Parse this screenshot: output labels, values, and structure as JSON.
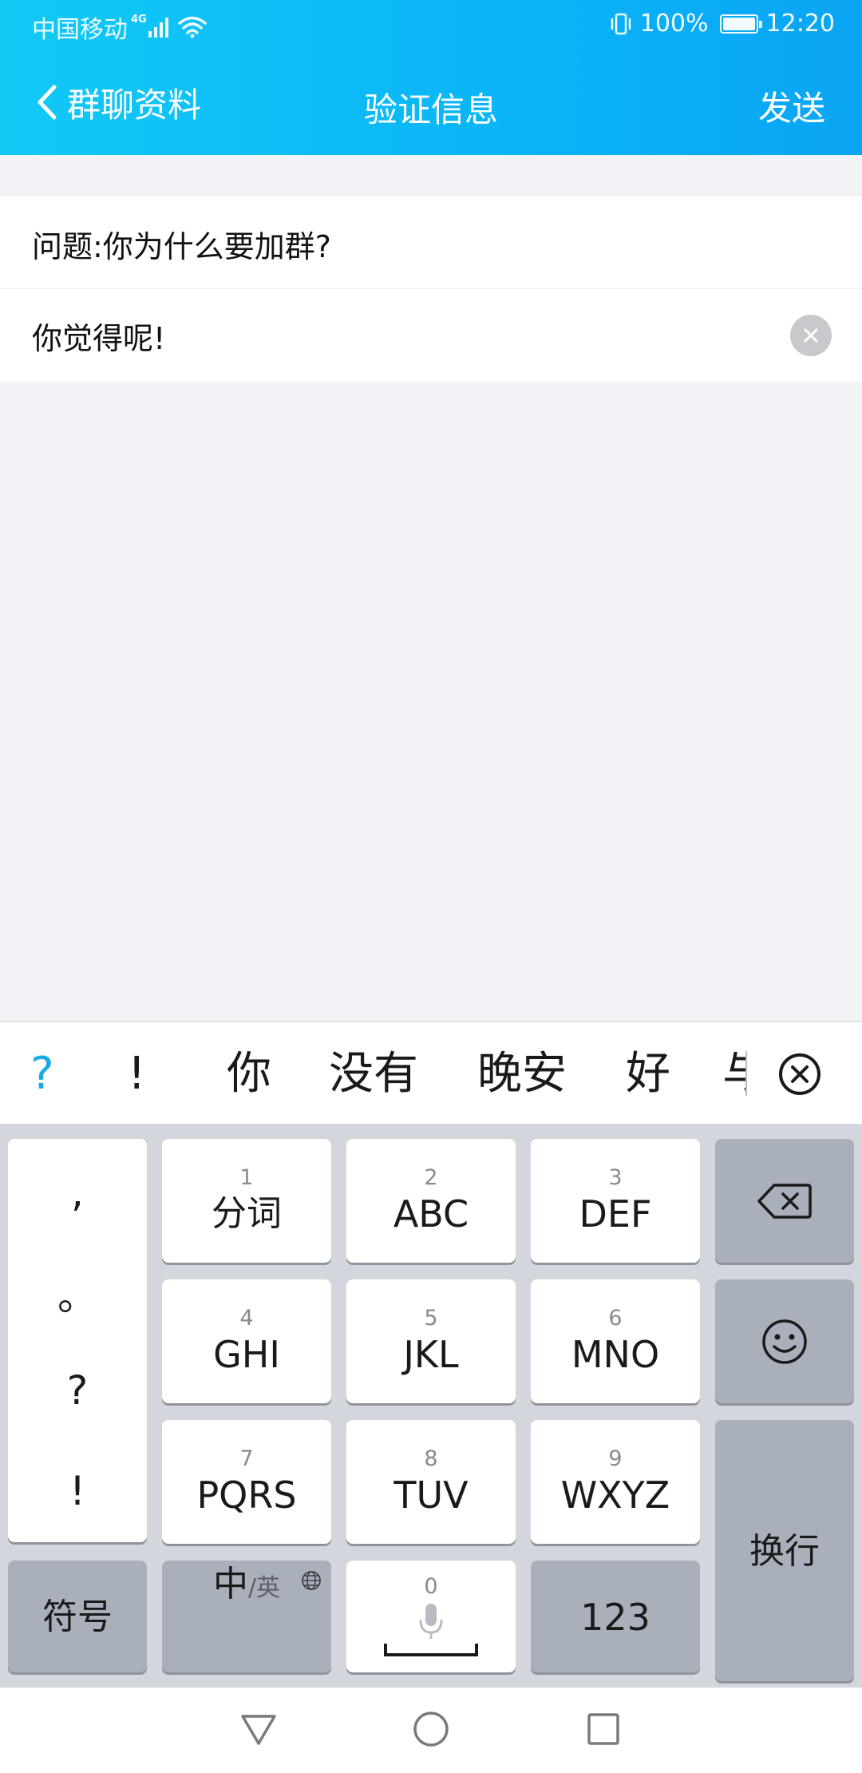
{
  "status_bar": {
    "carrier": "中国移动",
    "network": "4G",
    "battery": "100%",
    "battery_level": 1.0,
    "time": "12:20"
  },
  "nav": {
    "back_label": "群聊资料",
    "title": "验证信息",
    "send_label": "发送"
  },
  "form": {
    "question": "问题:你为什么要加群?",
    "answer_value": "你觉得呢!"
  },
  "candidates": {
    "items": [
      "?",
      "!",
      "你",
      "没有",
      "晚安",
      "好"
    ],
    "partial": "与"
  },
  "keyboard": {
    "punct": [
      ",",
      "。",
      "?",
      "!"
    ],
    "keys": [
      {
        "num": "1",
        "label": "分词"
      },
      {
        "num": "2",
        "label": "ABC"
      },
      {
        "num": "3",
        "label": "DEF"
      },
      {
        "num": "4",
        "label": "GHI"
      },
      {
        "num": "5",
        "label": "JKL"
      },
      {
        "num": "6",
        "label": "MNO"
      },
      {
        "num": "7",
        "label": "PQRS"
      },
      {
        "num": "8",
        "label": "TUV"
      },
      {
        "num": "9",
        "label": "WXYZ"
      }
    ],
    "symbols_label": "符号",
    "lang_main": "中",
    "lang_alt": "/英",
    "space_num": "0",
    "numbers_label": "123",
    "enter_label": "换行"
  },
  "icons": {
    "back": "chevron-left-icon",
    "clear": "clear-icon",
    "close_candidates": "close-circle-icon",
    "backspace": "backspace-icon",
    "emoji": "emoji-icon",
    "globe": "globe-icon",
    "mic": "mic-icon",
    "nav_back": "triangle-back-icon",
    "nav_home": "circle-home-icon",
    "nav_recent": "square-recent-icon"
  },
  "colors": {
    "header_start": "#12c9f6",
    "header_end": "#0aa5f4",
    "candidate_highlight": "#18a9e6",
    "key_gray": "#a9b0bb",
    "keyboard_bg": "#d3d6dc",
    "page_bg": "#f2f3f7"
  }
}
